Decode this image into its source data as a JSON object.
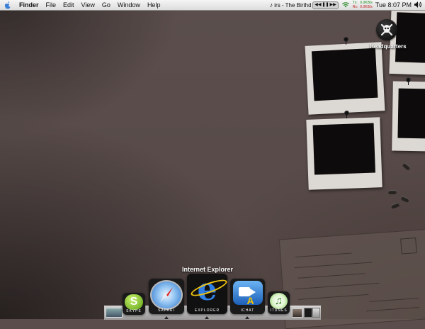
{
  "menubar": {
    "app_name": "Finder",
    "menus": [
      "File",
      "Edit",
      "View",
      "Go",
      "Window",
      "Help"
    ],
    "now_playing": "irs - The Birthd",
    "network": {
      "tx_label": "Tx:",
      "tx_value": "0.0KB/s",
      "rx_label": "Rx:",
      "rx_value": "0.0KB/s"
    },
    "clock": "Tue 8:07 PM",
    "icons": [
      "apple-icon",
      "music-note-icon",
      "wifi-icon",
      "volume-icon"
    ]
  },
  "desktop": {
    "icons": [
      {
        "label": "Headquarters",
        "icon": "skull-crossbones-icon"
      }
    ]
  },
  "dock": {
    "tooltip": "Internet Explorer",
    "apps": [
      {
        "name": "Skype",
        "caption": "SKYPE",
        "color": "#7bc21e"
      },
      {
        "name": "Safari",
        "caption": "SAFARI",
        "color": "#3a84d6"
      },
      {
        "name": "Internet Explorer",
        "caption": "EXPLORER",
        "color": "#1f5fc4"
      },
      {
        "name": "iChat",
        "caption": "ICHAT",
        "color": "#3a7fd0"
      },
      {
        "name": "iTunes",
        "caption": "ITUNES",
        "color": "#4fa12a"
      }
    ]
  }
}
